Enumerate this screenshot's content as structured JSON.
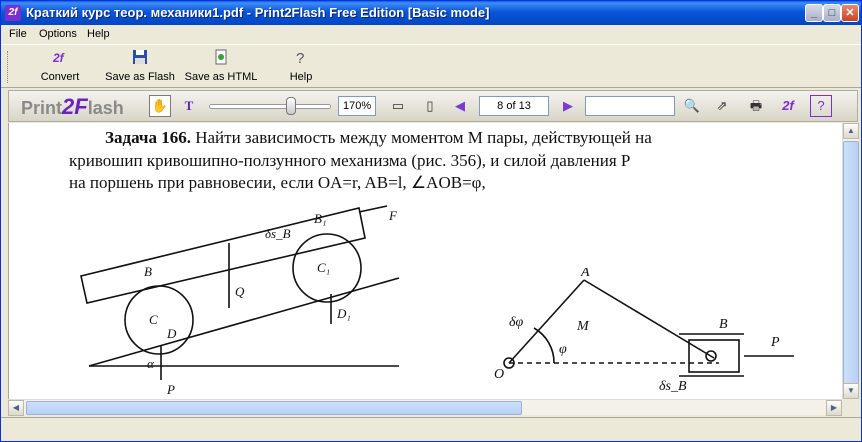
{
  "window": {
    "title": "Краткий курс теор. механики1.pdf - Print2Flash Free Edition [Basic mode]"
  },
  "menu": {
    "items": [
      "File",
      "Options",
      "Help"
    ]
  },
  "toolbar": {
    "convert": "Convert",
    "save_flash": "Save as Flash",
    "save_html": "Save as HTML",
    "help": "Help"
  },
  "viewer": {
    "logo_left": "Print",
    "logo_mark": "2F",
    "logo_right": "lash",
    "zoom": "170%",
    "page": "8 of 13",
    "search_value": ""
  },
  "document": {
    "problem_label": "Задача 166.",
    "line1_text": " Найти зависимость между моментом M пары, действующей на",
    "line2_text": "кривошип кривошипно-ползунного механизма (рис. 356), и силой давления P",
    "line3_text": "на поршень при равновесии, если OA=r, AB=l, ∠AOB=φ,",
    "fig_left_labels": [
      "B",
      "B₁",
      "δs_B",
      "F",
      "Q",
      "C",
      "C₁",
      "D",
      "D₁",
      "α",
      "P"
    ],
    "fig_right_labels": [
      "A",
      "B",
      "M",
      "δφ",
      "φ",
      "O",
      "P",
      "δs_B"
    ]
  }
}
